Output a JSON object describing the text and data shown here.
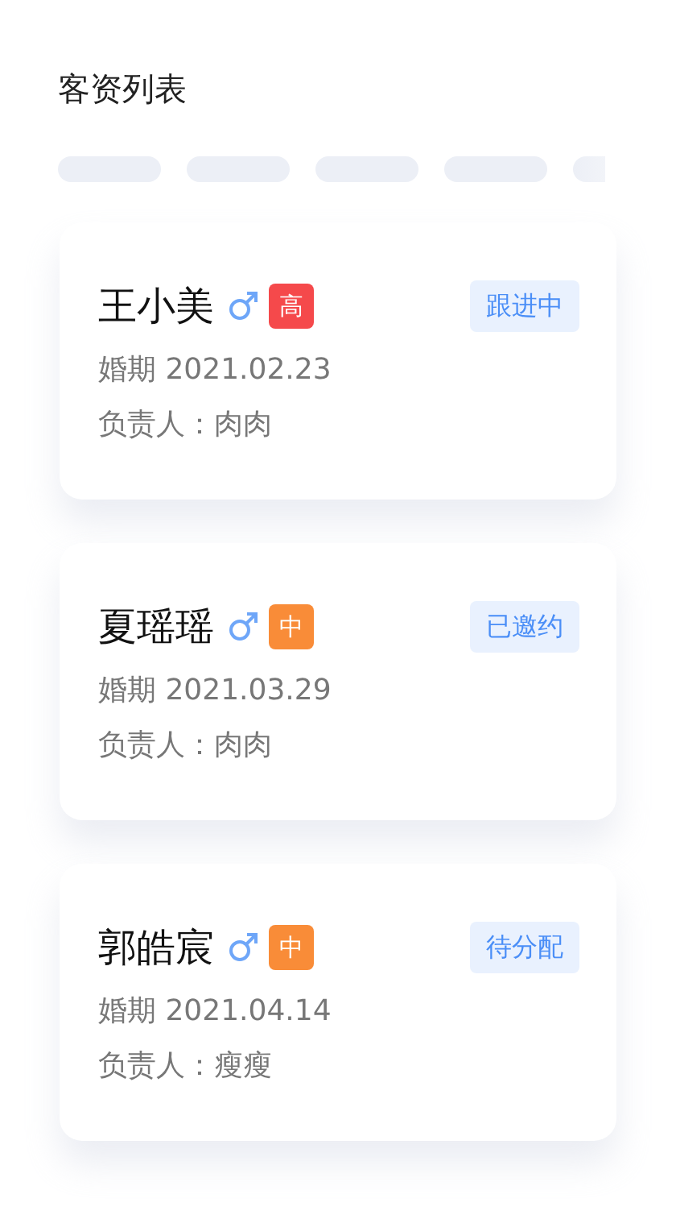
{
  "title": "客资列表",
  "filter_chips": [
    {
      "kind": "placeholder"
    },
    {
      "kind": "placeholder"
    },
    {
      "kind": "placeholder"
    },
    {
      "kind": "placeholder"
    },
    {
      "kind": "faded"
    }
  ],
  "customers": [
    {
      "name": "王小美",
      "gender": {
        "kind": "male"
      },
      "priority": {
        "text": "高",
        "color": "#f5494b"
      },
      "status": "跟进中",
      "wedding_date": "婚期 2021.02.23",
      "owner": "负责人：肉肉"
    },
    {
      "name": "夏瑶瑶",
      "gender": {
        "kind": "male"
      },
      "priority": {
        "text": "中",
        "color": "#f98c38"
      },
      "status": "已邀约",
      "wedding_date": "婚期 2021.03.29",
      "owner": "负责人：肉肉"
    },
    {
      "name": "郭皓宸",
      "gender": {
        "kind": "male"
      },
      "priority": {
        "text": "中",
        "color": "#f98c38"
      },
      "status": "待分配",
      "wedding_date": "婚期 2021.04.14",
      "owner": "负责人：瘦瘦"
    }
  ]
}
